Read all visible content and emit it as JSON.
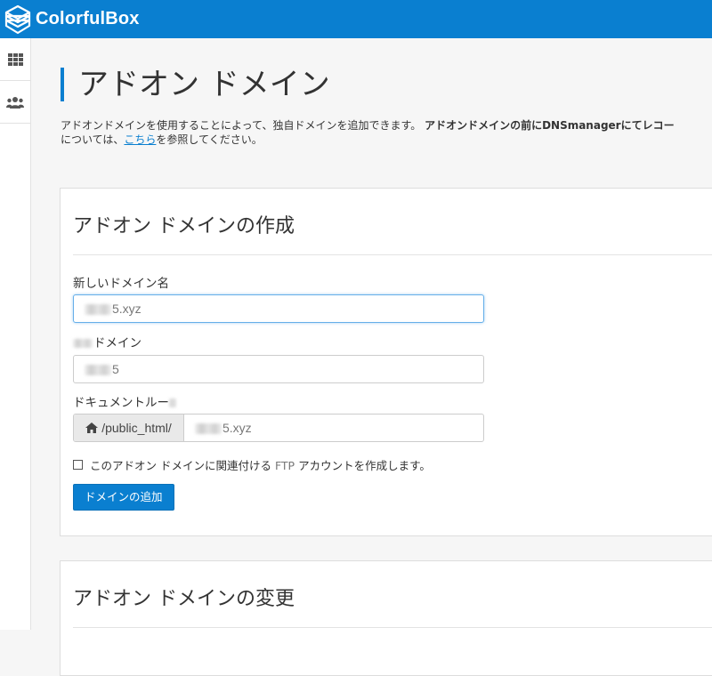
{
  "app": {
    "brand": "ColorfulBox"
  },
  "sidebar": {
    "items": [
      {
        "icon": "grid-icon"
      },
      {
        "icon": "users-icon"
      }
    ]
  },
  "page": {
    "title": "アドオン ドメイン",
    "description": {
      "part1": "アドオンドメインを使用することによって、独自ドメインを追加できます。 ",
      "bold": "アドオンドメインの前にDNSmanagerにてレコー",
      "line2_prefix": "については、",
      "link": "こちら",
      "line2_suffix": "を参照してください。"
    }
  },
  "create_panel": {
    "title": "アドオン ドメインの作成",
    "new_domain_label": "新しいドメイン名",
    "new_domain_value": "5.xyz",
    "subdomain_label": "ドメイン",
    "subdomain_value": "5",
    "docroot_label": "ドキュメントルー",
    "docroot_prefix": "/public_html/",
    "docroot_value": "5.xyz",
    "ftp_checkbox": {
      "pre": "このアドオン ドメインに関連付ける ",
      "ftp": "FTP",
      "post": " アカウントを作成します。",
      "checked": false
    },
    "submit_label": "ドメインの追加"
  },
  "change_panel": {
    "title": "アドオン ドメインの変更"
  },
  "colors": {
    "primary": "#0a7fd0",
    "background": "#f6f6f6"
  }
}
